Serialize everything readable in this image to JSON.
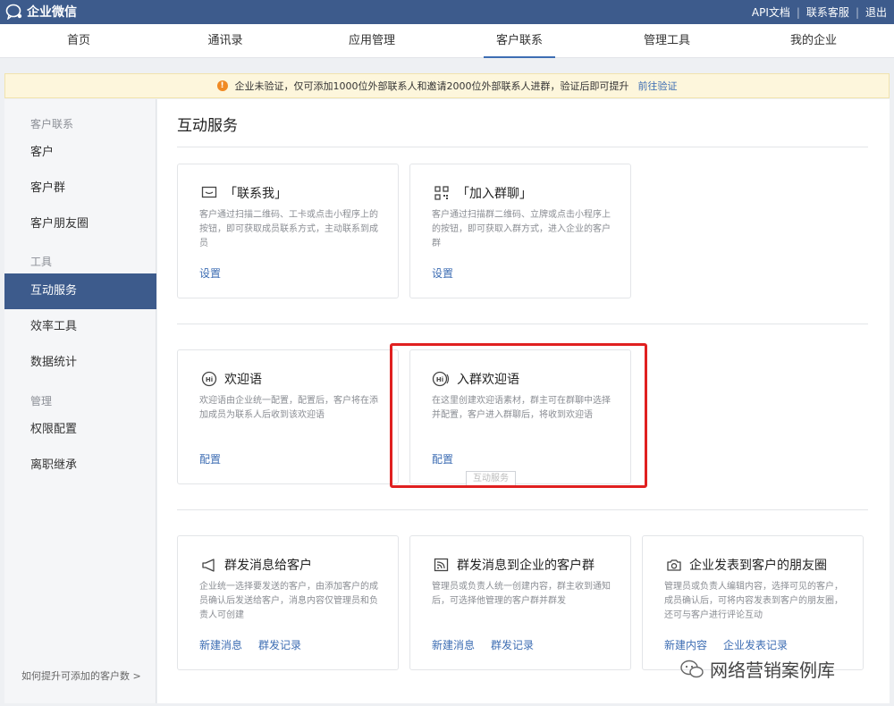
{
  "topbar": {
    "logo_text": "企业微信",
    "links": [
      "API文档",
      "联系客服",
      "退出"
    ]
  },
  "nav": {
    "tabs": [
      "首页",
      "通讯录",
      "应用管理",
      "客户联系",
      "管理工具",
      "我的企业"
    ],
    "active": "客户联系"
  },
  "notice": {
    "text": "企业未验证，仅可添加1000位外部联系人和邀请2000位外部联系人进群，验证后即可提升",
    "link": "前往验证"
  },
  "sidebar": {
    "groups": [
      {
        "label": "客户联系",
        "items": [
          "客户",
          "客户群",
          "客户朋友圈"
        ]
      },
      {
        "label": "工具",
        "items": [
          "互动服务",
          "效率工具",
          "数据统计"
        ]
      },
      {
        "label": "管理",
        "items": [
          "权限配置",
          "离职继承"
        ]
      }
    ],
    "active": "互动服务",
    "footer": "如何提升可添加的客户数 >"
  },
  "main": {
    "title": "互动服务",
    "cards": [
      {
        "icon": "chat-bubble-icon",
        "title": "「联系我」",
        "desc": "客户通过扫描二维码、工卡或点击小程序上的按钮，即可获取成员联系方式，主动联系到成员",
        "links": [
          "设置"
        ]
      },
      {
        "icon": "qrcode-icon",
        "title": "「加入群聊」",
        "desc": "客户通过扫描群二维码、立牌或点击小程序上的按钮，即可获取入群方式，进入企业的客户群",
        "links": [
          "设置"
        ]
      },
      {
        "icon": "hi-bubble-icon",
        "title": "欢迎语",
        "desc": "欢迎语由企业统一配置，配置后，客户将在添加成员为联系人后收到该欢迎语",
        "links": [
          "配置"
        ]
      },
      {
        "icon": "hi-group-icon",
        "title": "入群欢迎语",
        "desc": "在这里创建欢迎语素材，群主可在群聊中选择并配置，客户进入群聊后，将收到欢迎语",
        "links": [
          "配置"
        ]
      },
      {
        "icon": "megaphone-icon",
        "title": "群发消息给客户",
        "desc": "企业统一选择要发送的客户，由添加客户的成员确认后发送给客户，消息内容仅管理员和负责人可创建",
        "links": [
          "新建消息",
          "群发记录"
        ]
      },
      {
        "icon": "broadcast-icon",
        "title": "群发消息到企业的客户群",
        "desc": "管理员或负责人统一创建内容，群主收到通知后，可选择他管理的客户群并群发",
        "links": [
          "新建消息",
          "群发记录"
        ]
      },
      {
        "icon": "camera-icon",
        "title": "企业发表到客户的朋友圈",
        "desc": "管理员或负责人编辑内容，选择可见的客户，成员确认后，可将内容发表到客户的朋友圈，还可与客户进行评论互动",
        "links": [
          "新建内容",
          "企业发表记录"
        ]
      }
    ],
    "tooltip": "互动服务"
  },
  "watermark": {
    "text": "网络营销案例库"
  }
}
